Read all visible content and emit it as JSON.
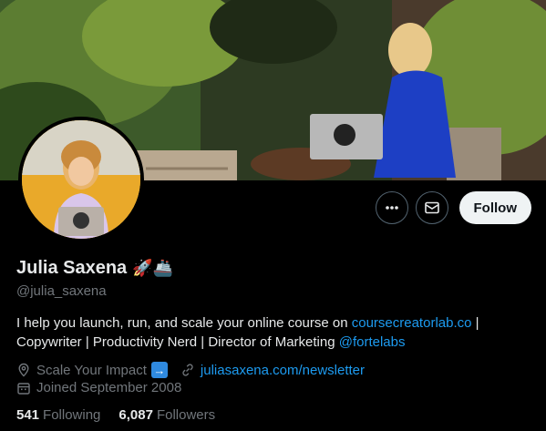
{
  "profile": {
    "name": "Julia Saxena",
    "name_emojis": "🚀🚢",
    "handle": "@julia_saxena"
  },
  "actions": {
    "more_icon": "more-horizontal-icon",
    "message_icon": "mail-icon",
    "follow_label": "Follow"
  },
  "bio": {
    "line1_text": "I help you launch, run, and scale your online course on ",
    "line1_link": "coursecreatorlab.co",
    "line1_suffix": " |",
    "line2_text": "Copywriter | Productivity Nerd | Director of Marketing ",
    "line2_link": "@fortelabs"
  },
  "meta": {
    "location": "Scale Your Impact",
    "location_emoji": "➡️",
    "website": "juliasaxena.com/newsletter",
    "joined": "Joined September 2008"
  },
  "stats": {
    "following_count": "541",
    "following_label": "Following",
    "followers_count": "6,087",
    "followers_label": "Followers"
  },
  "colors": {
    "link": "#1d9bf0",
    "muted": "#71767b",
    "background": "#000000"
  }
}
